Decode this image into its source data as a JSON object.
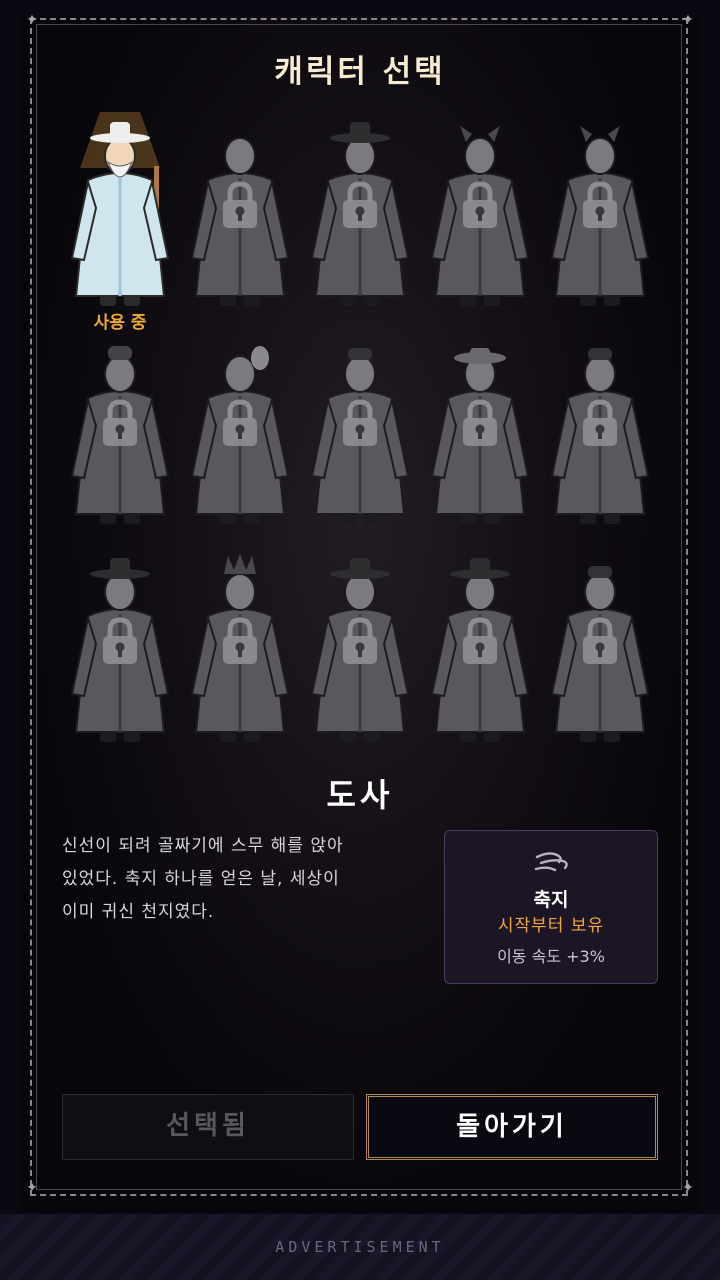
{
  "title": "캐릭터 선택",
  "characters": [
    {
      "id": "dosa",
      "status": "사용 중",
      "locked": false
    },
    {
      "id": "monk",
      "locked": true
    },
    {
      "id": "scholar",
      "locked": true
    },
    {
      "id": "goblin",
      "locked": true
    },
    {
      "id": "ogre",
      "locked": true
    },
    {
      "id": "woman",
      "locked": true
    },
    {
      "id": "mask-dancer",
      "locked": true
    },
    {
      "id": "hunter",
      "locked": true
    },
    {
      "id": "farmer",
      "locked": true
    },
    {
      "id": "swordsman",
      "locked": true
    },
    {
      "id": "traveler",
      "locked": true
    },
    {
      "id": "shaman",
      "locked": true
    },
    {
      "id": "official",
      "locked": true
    },
    {
      "id": "elder",
      "locked": true
    },
    {
      "id": "star-mage",
      "locked": true
    }
  ],
  "selected": {
    "name": "도사",
    "description_lines": [
      "신선이 되려 골짜기에 스무 해를 앉아",
      "있었다. 축지 하나를 얻은 날, 세상이",
      "이미 귀신 천지였다."
    ],
    "skill": {
      "icon": "wind-icon",
      "name": "축지",
      "tag": "시작부터 보유",
      "effect": "이동 속도 +3%"
    }
  },
  "buttons": {
    "selected_label": "선택됨",
    "back_label": "돌아가기"
  },
  "ad_label": "ADVERTISEMENT",
  "colors": {
    "accent": "#f0a83c",
    "button_border": "#b08a5c",
    "card_bg": "#1c1526"
  }
}
